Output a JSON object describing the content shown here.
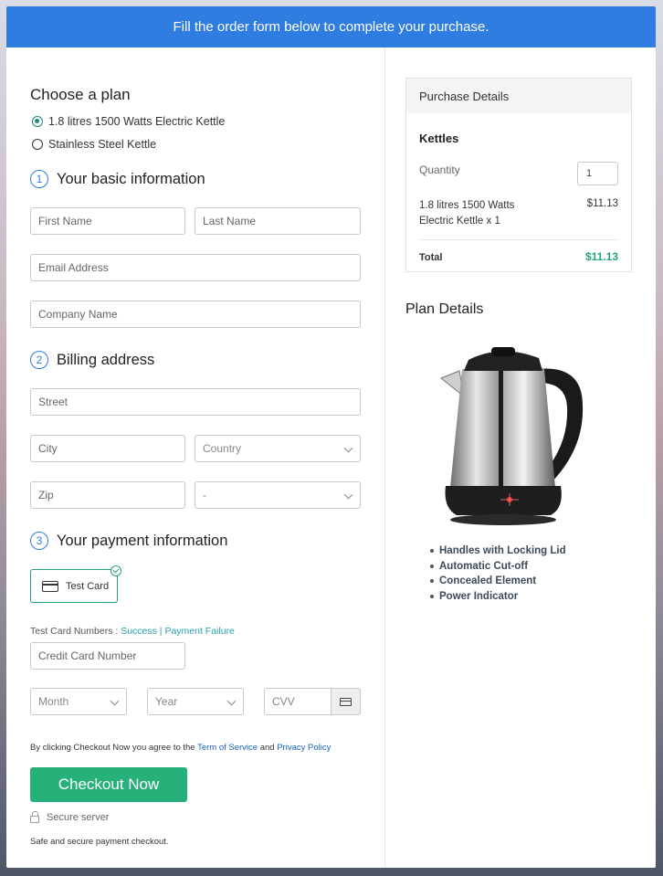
{
  "banner": {
    "text": "Fill the order form below to complete your purchase."
  },
  "plan": {
    "title": "Choose a plan",
    "options": [
      {
        "label": "1.8 litres 1500 Watts Electric Kettle",
        "selected": true
      },
      {
        "label": "Stainless Steel Kettle",
        "selected": false
      }
    ]
  },
  "basic": {
    "num": "1",
    "title": "Your basic information",
    "first_name_placeholder": "First Name",
    "last_name_placeholder": "Last Name",
    "email_placeholder": "Email Address",
    "company_placeholder": "Company Name"
  },
  "billing": {
    "num": "2",
    "title": "Billing address",
    "street_placeholder": "Street",
    "city_placeholder": "City",
    "country_placeholder": "Country",
    "zip_placeholder": "Zip",
    "state_placeholder": "-"
  },
  "payment": {
    "num": "3",
    "title": "Your payment information",
    "card_tile_label": "Test Card",
    "test_numbers_label": "Test Card Numbers : ",
    "success_link": "Success",
    "separator": " | ",
    "failure_link": "Payment Failure",
    "card_number_placeholder": "Credit Card Number",
    "month_placeholder": "Month",
    "year_placeholder": "Year",
    "cvv_placeholder": "CVV"
  },
  "agreement": {
    "prefix": "By clicking Checkout Now you agree to the ",
    "terms_link": "Term of Service",
    "and": " and ",
    "privacy_link": "Privacy Policy"
  },
  "checkout_button": "Checkout Now",
  "secure_server": "Secure server",
  "safe_text": "Safe and secure payment checkout.",
  "purchase": {
    "header": "Purchase Details",
    "product_group": "Kettles",
    "quantity_label": "Quantity",
    "quantity_value": "1",
    "item_label": "1.8 litres 1500 Watts Electric Kettle x 1",
    "item_price": "$11.13",
    "total_label": "Total",
    "total_value": "$11.13"
  },
  "plan_details": {
    "title": "Plan Details",
    "features": [
      "Handles with Locking Lid",
      "Automatic Cut-off",
      "Concealed Element",
      "Power Indicator"
    ]
  },
  "colors": {
    "banner": "#2f7de1",
    "accent_green": "#26b07a",
    "link_teal": "#26a0a9",
    "link_blue": "#1a5fb4"
  }
}
